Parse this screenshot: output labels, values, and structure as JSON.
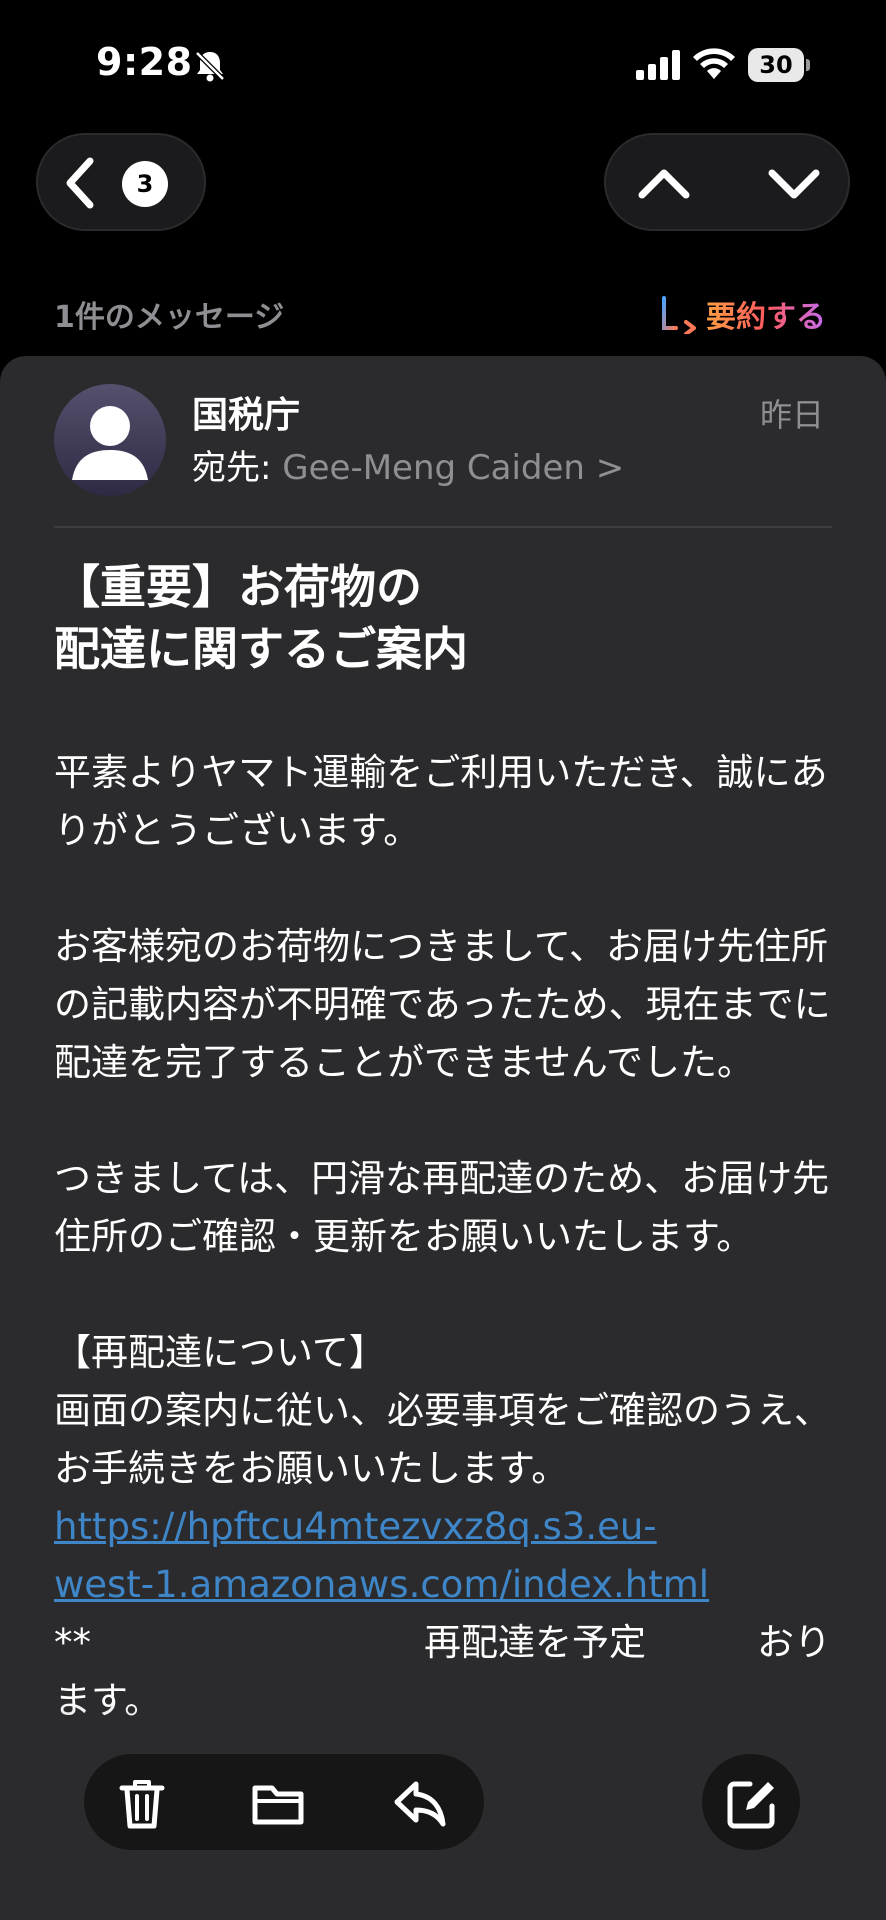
{
  "status_bar": {
    "time": "9:28",
    "battery": "30",
    "icons": [
      "bell-slash-icon",
      "cellular-signal-icon",
      "wifi-icon",
      "battery-icon"
    ]
  },
  "nav": {
    "back_count": "3",
    "icons": [
      "chevron-left-icon",
      "chevron-up-icon",
      "chevron-down-icon"
    ]
  },
  "thread": {
    "message_count": "1件のメッセージ",
    "summarize_label": "要約する"
  },
  "email": {
    "sender": "国税庁",
    "to_label": "宛先: ",
    "to_name": "Gee-Meng Caiden",
    "to_chevron": ">",
    "date": "昨日",
    "subject_line1": "【重要】お荷物の",
    "subject_line2": "配達に関するご案内",
    "para1": "平素よりヤマト運輸をご利用いただき、誠にありがとうございます。",
    "para2": "お客様宛のお荷物につきまして、お届け先住所の記載内容が不明確であったため、現在までに配達を完了することができませんでした。",
    "para3": "つきましては、円滑な再配達のため、お届け先住所のご確認・更新をお願いいたします。",
    "section_heading": "【再配達について】",
    "para4": "画面の案内に従い、必要事項をご確認のうえ、お手続きをお願いいたします。",
    "link_line1": "https://hpftcu4mtezvxz8q.s3.eu-",
    "link_line2": "west-1.amazonaws.com/index.html",
    "footer_partial": "**　　　　　　　　　再配達を予定　　　おります。"
  },
  "toolbar": {
    "icons": [
      "trash-icon",
      "folder-icon",
      "reply-icon",
      "compose-icon"
    ]
  },
  "colors": {
    "background": "#000000",
    "card": "#2b2b2d",
    "link": "#3f86c8",
    "secondary_text": "#8e8e93"
  }
}
